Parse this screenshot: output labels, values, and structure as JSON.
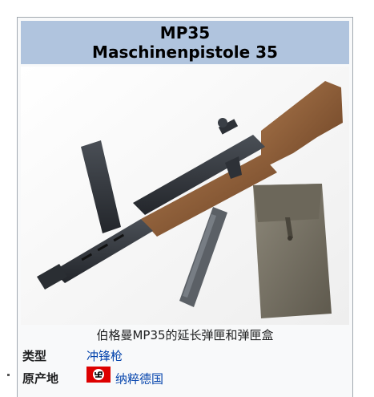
{
  "infobox": {
    "title_line1": "MP35",
    "title_line2": "Maschinenpistole 35",
    "caption": "伯格曼MP35的延长弹匣和弹匣盒",
    "rows": [
      {
        "label": "类型",
        "value": "冲锋枪"
      },
      {
        "label": "原产地",
        "value": "纳粹德国"
      }
    ],
    "colors": {
      "title_bg": "#b0c4de",
      "box_bg": "#f8f9fa",
      "border": "#a2a9b1",
      "link": "#0645ad",
      "flag_red": "#dd0000"
    },
    "image_subject": "MP35 submachine gun with extended magazine and leather magazine pouch",
    "flag_icon": "flag-icon"
  }
}
